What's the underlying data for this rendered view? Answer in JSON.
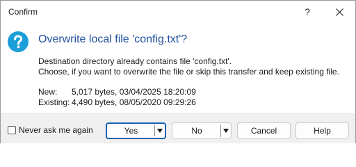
{
  "window": {
    "title": "Confirm"
  },
  "titlebar": {
    "help_label": "?"
  },
  "message": {
    "heading": "Overwrite local file 'config.txt'?",
    "line1": "Destination directory already contains file 'config.txt'.",
    "line2": "Choose, if you want to overwrite the file or skip this transfer and keep existing file."
  },
  "details": {
    "new_label": "New:",
    "new_value": "5,017 bytes, 03/04/2025 18:20:09",
    "existing_label": "Existing:",
    "existing_value": "4,490 bytes, 08/05/2020 09:29:26"
  },
  "footer": {
    "never_ask_label": "Never ask me again",
    "yes_label": "Yes",
    "no_label": "No",
    "cancel_label": "Cancel",
    "help_label": "Help"
  },
  "colors": {
    "heading": "#1f4e9e",
    "question_icon": "#1c9fd8",
    "primary_border": "#1a5fb4"
  },
  "icons": {
    "dialog": "question-icon",
    "close": "close-icon"
  }
}
